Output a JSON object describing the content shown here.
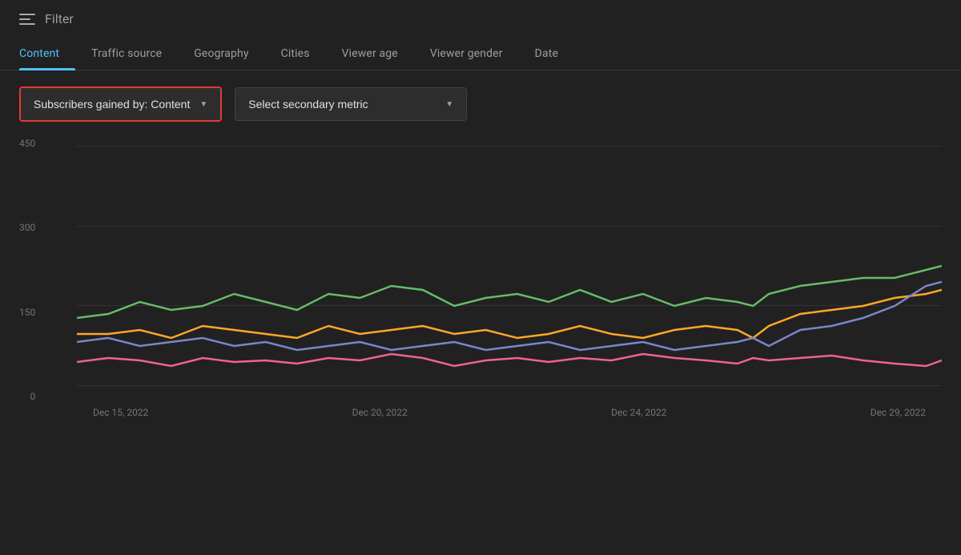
{
  "filterBar": {
    "filterLabel": "Filter"
  },
  "tabs": [
    {
      "id": "content",
      "label": "Content",
      "active": true
    },
    {
      "id": "traffic-source",
      "label": "Traffic source",
      "active": false
    },
    {
      "id": "geography",
      "label": "Geography",
      "active": false
    },
    {
      "id": "cities",
      "label": "Cities",
      "active": false
    },
    {
      "id": "viewer-age",
      "label": "Viewer age",
      "active": false
    },
    {
      "id": "viewer-gender",
      "label": "Viewer gender",
      "active": false
    },
    {
      "id": "date",
      "label": "Date",
      "active": false
    }
  ],
  "dropdowns": {
    "primary": {
      "label": "Subscribers gained by: Content",
      "chevron": "▼"
    },
    "secondary": {
      "label": "Select secondary metric",
      "chevron": "▼"
    }
  },
  "chart": {
    "yLabels": [
      "450",
      "300",
      "150",
      "0"
    ],
    "xLabels": [
      "Dec 15, 2022",
      "Dec 20, 2022",
      "Dec 24, 2022",
      "Dec 29, 2022"
    ],
    "colors": {
      "green": "#66bb6a",
      "orange": "#ffa726",
      "blue": "#7986cb",
      "pink": "#f06292",
      "teal": "#26c6da"
    }
  }
}
